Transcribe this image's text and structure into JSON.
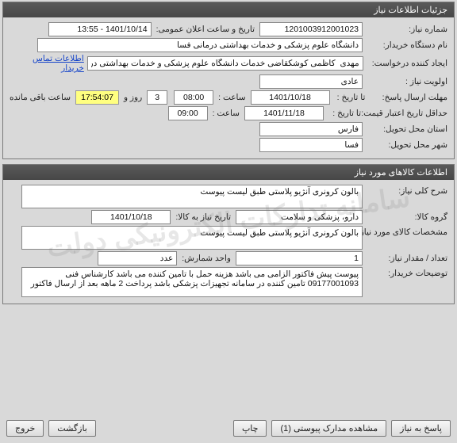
{
  "watermark": "سامانه تدارکات الکترونیکی دولت",
  "panel1": {
    "title": "جزئیات اطلاعات نیاز",
    "need_no_label": "شماره نیاز:",
    "need_no": "1201003912001023",
    "announce_label": "تاریخ و ساعت اعلان عمومی:",
    "announce_value": "1401/10/14 - 13:55",
    "buyer_org_label": "نام دستگاه خریدار:",
    "buyer_org": "دانشگاه علوم پزشکی و خدمات بهداشتی درمانی فسا",
    "requester_label": "ایجاد کننده درخواست:",
    "requester": "مهدی  کاظمی کوشکقاضی خدمات دانشگاه علوم پزشکی و خدمات بهداشتی درمانی فسا",
    "contact_link": "اطلاعات تماس خریدار",
    "priority_label": "اولویت نیاز :",
    "priority": "عادی",
    "answer_deadline_label": "مهلت ارسال پاسخ:",
    "until_label": "تا تاریخ :",
    "answer_date": "1401/10/18",
    "time_label": "ساعت :",
    "answer_time": "08:00",
    "days_value": "3",
    "days_label": "روز و",
    "remaining_time": "17:54:07",
    "remaining_label": "ساعت باقی مانده",
    "price_validity_label": "حداقل تاریخ اعتبار قیمت:",
    "price_validity_date": "1401/11/18",
    "price_validity_time": "09:00",
    "province_label": "استان محل تحویل:",
    "province": "فارس",
    "city_label": "شهر محل تحویل:",
    "city": "فسا"
  },
  "panel2": {
    "title": "اطلاعات کالاهای مورد نیاز",
    "summary_label": "شرح کلی نیاز:",
    "summary": "بالون کرونری آنژیو پلاستی طبق لیست پیوست",
    "group_label": "گروه کالا:",
    "group": "دارو، پزشکی و سلامت",
    "need_date_label": "تاریخ نیاز به کالا:",
    "need_date": "1401/10/18",
    "spec_label": "مشخصات کالای مورد نیاز:",
    "spec": "بالون کرونری آنژیو پلاستی طبق لیست پیوست",
    "qty_label": "تعداد / مقدار نیاز:",
    "qty": "1",
    "unit_label": "واحد شمارش:",
    "unit": "عدد",
    "buyer_notes_label": "توضیحات خریدار:",
    "buyer_notes": "پیوست پیش فاکتور الزامی می باشد هزینه حمل با تامین کننده می باشد کارشناس فنی 09177001093 تامین کننده در سامانه تجهیزات پزشکی باشد پرداخت 2 ماهه بعد از ارسال فاکتور"
  },
  "footer": {
    "answer": "پاسخ به نیاز",
    "attachments": "مشاهده مدارک پیوستی (1)",
    "print": "چاپ",
    "back": "بازگشت",
    "exit": "خروج"
  }
}
